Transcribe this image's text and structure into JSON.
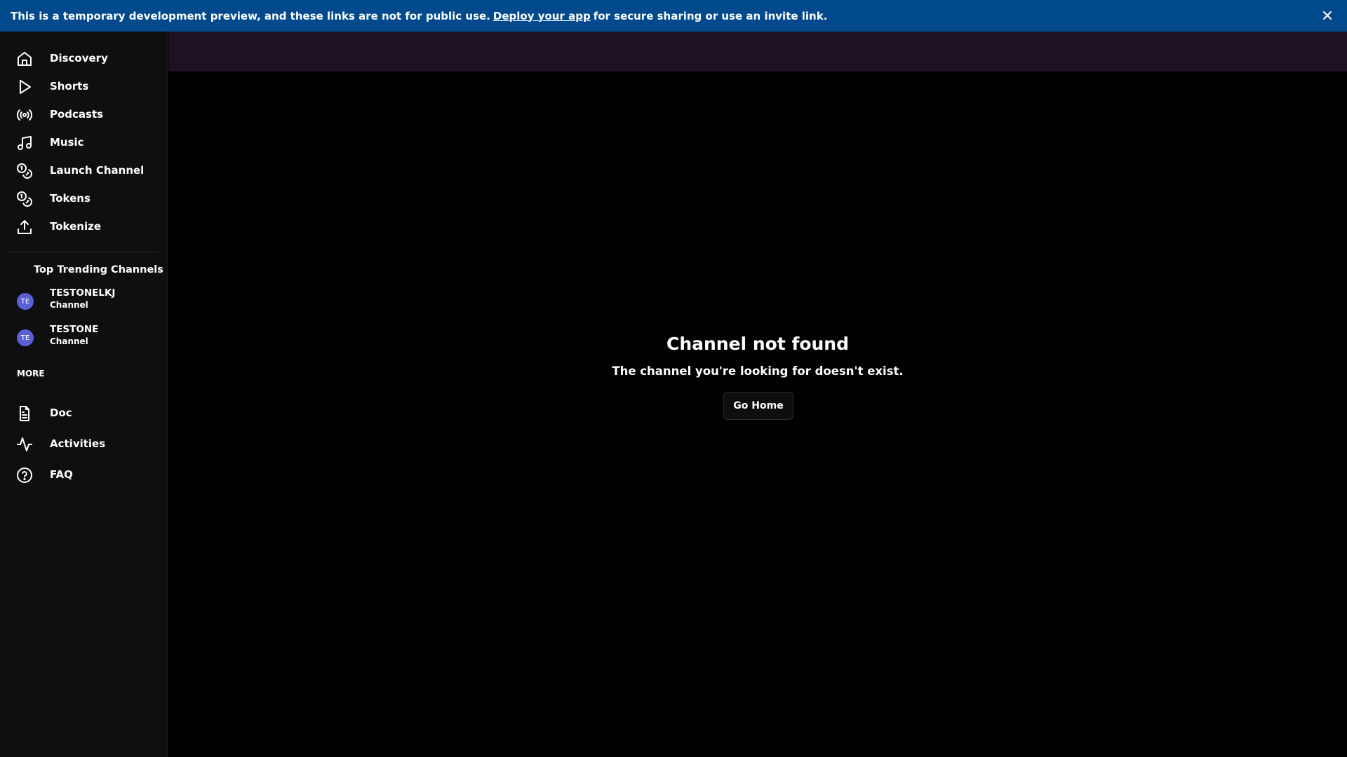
{
  "banner": {
    "text_before": "This is a temporary development preview, and these links are not for public use.",
    "link": "Deploy your app",
    "text_after": "for secure sharing or use an invite link.",
    "bg_color": "#00498d"
  },
  "sidebar": {
    "nav": [
      {
        "label": "Discovery",
        "icon": "home-icon"
      },
      {
        "label": "Shorts",
        "icon": "play-icon"
      },
      {
        "label": "Podcasts",
        "icon": "broadcast-icon"
      },
      {
        "label": "Music",
        "icon": "music-note-icon"
      },
      {
        "label": "Launch Channel",
        "icon": "coins-icon"
      },
      {
        "label": "Tokens",
        "icon": "coins-icon"
      },
      {
        "label": "Tokenize",
        "icon": "upload-icon"
      }
    ],
    "trending_title": "Top Trending Channels",
    "channels": [
      {
        "initials": "TE",
        "name": "TESTONELKJ",
        "type": "Channel"
      },
      {
        "initials": "TE",
        "name": "TESTONE",
        "type": "Channel"
      }
    ],
    "more_title": "MORE",
    "more": [
      {
        "label": "Doc",
        "icon": "document-icon"
      },
      {
        "label": "Activities",
        "icon": "activity-icon"
      },
      {
        "label": "FAQ",
        "icon": "help-circle-icon"
      }
    ]
  },
  "main": {
    "title": "Channel not found",
    "subtitle": "The channel you're looking for doesn't exist.",
    "button": "Go Home"
  },
  "colors": {
    "sidebar_bg": "#0f0f0f",
    "topbar_bg": "#1c1221",
    "avatar_bg": "#5b5fd6"
  }
}
